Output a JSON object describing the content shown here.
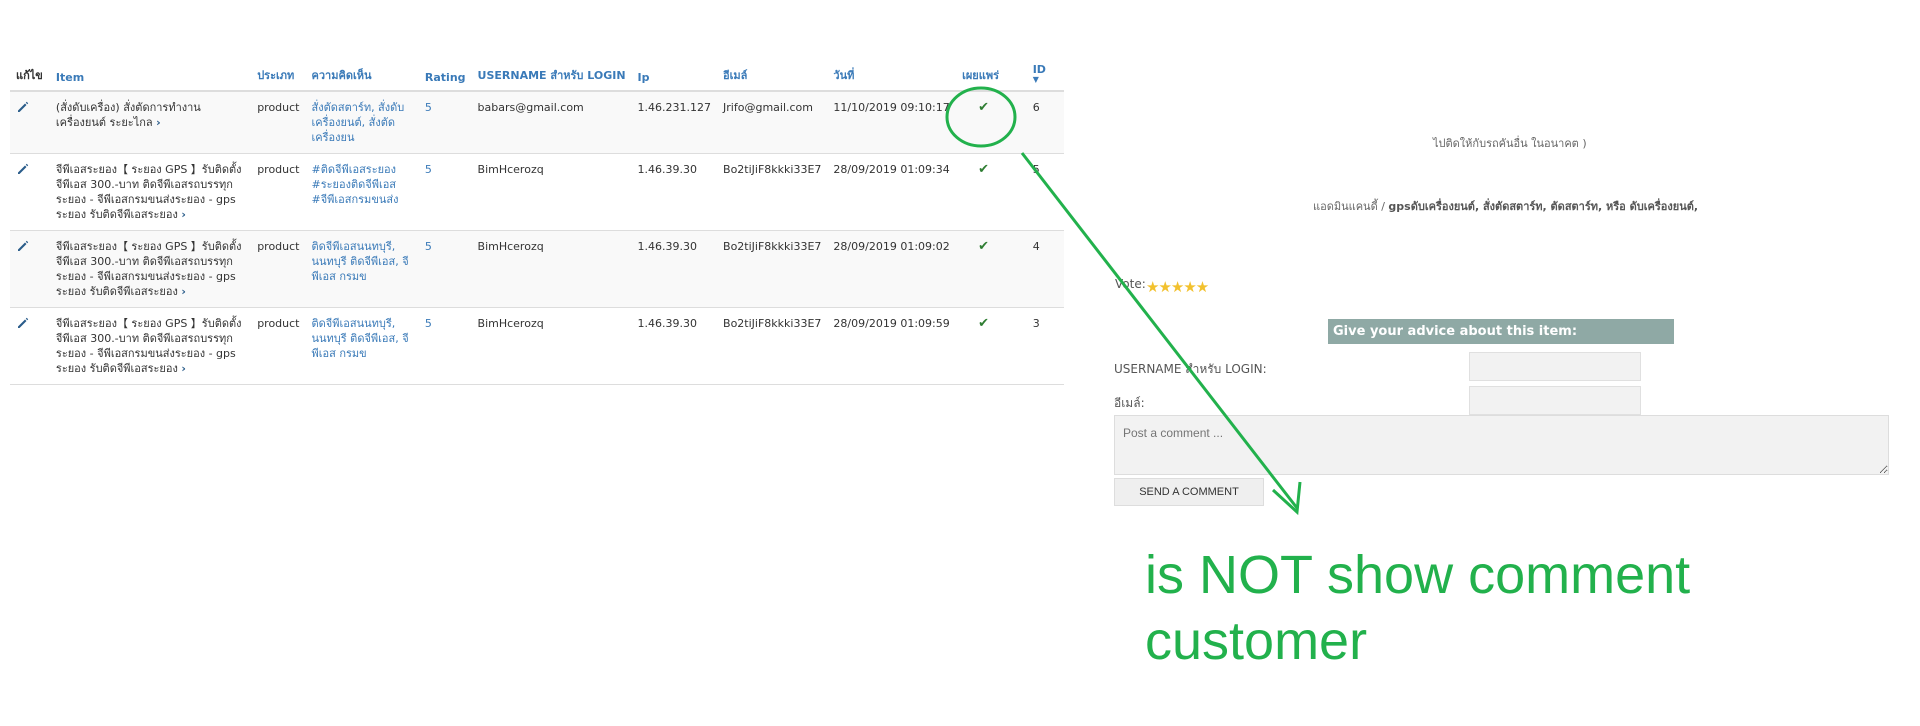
{
  "table": {
    "headers": {
      "edit": "แก้ไข",
      "item": "Item",
      "type": "ประเภท",
      "comment": "ความคิดเห็น",
      "rating": "Rating",
      "username": "USERNAME สำหรับ LOGIN",
      "ip": "Ip",
      "email": "อีเมล์",
      "date": "วันที่",
      "published": "เผยแพร่",
      "id": "ID",
      "id_sort": "▼"
    },
    "rows": [
      {
        "item": "(สั่งดับเครื่อง) สั่งตัดการทำงานเครื่องยนต์ ระยะไกล",
        "type": "product",
        "comment": "สั่งตัดสตาร์ท, สั่งดับ เครื่องยนต์, สั่งตัด เครื่องยน",
        "rating": "5",
        "username": "babars@gmail.com",
        "ip": "1.46.231.127",
        "email": "Jrifo@gmail.com",
        "date": "11/10/2019 09:10:17",
        "id": "6"
      },
      {
        "item": "จีพีเอสระยอง【 ระยอง GPS 】รับติดตั้ง จีพีเอส 300.-บาท ติดจีพีเอสรถบรรทุก ระยอง - จีพีเอสกรมขนส่งระยอง - gps ระยอง รับติดจีพีเอสระยอง",
        "type": "product",
        "comment": "#ติดจีพีเอสระยอง #ระยองติดจีพีเอส #จีพีเอสกรมขนส่ง",
        "rating": "5",
        "username": "BimHcerozq",
        "ip": "1.46.39.30",
        "email": "Bo2tiJiF8kkki33E7",
        "date": "28/09/2019 01:09:34",
        "id": "5"
      },
      {
        "item": "จีพีเอสระยอง【 ระยอง GPS 】รับติดตั้ง จีพีเอส 300.-บาท ติดจีพีเอสรถบรรทุก ระยอง - จีพีเอสกรมขนส่งระยอง - gps ระยอง รับติดจีพีเอสระยอง",
        "type": "product",
        "comment": "ติดจีพีเอสนนทบุรี, นนทบุรี ติดจีพีเอส, จีพีเอส กรมข",
        "rating": "5",
        "username": "BimHcerozq",
        "ip": "1.46.39.30",
        "email": "Bo2tiJiF8kkki33E7",
        "date": "28/09/2019 01:09:02",
        "id": "4"
      },
      {
        "item": "จีพีเอสระยอง【 ระยอง GPS 】รับติดตั้ง จีพีเอส 300.-บาท ติดจีพีเอสรถบรรทุก ระยอง - จีพีเอสกรมขนส่งระยอง - gps ระยอง รับติดจีพีเอสระยอง",
        "type": "product",
        "comment": "ติดจีพีเอสนนทบุรี, นนทบุรี ติดจีพีเอส, จีพีเอส กรมข",
        "rating": "5",
        "username": "BimHcerozq",
        "ip": "1.46.39.30",
        "email": "Bo2tiJiF8kkki33E7",
        "date": "28/09/2019 01:09:59",
        "id": "3"
      }
    ]
  },
  "article": {
    "snippet1": "ไปติดให้กับรถคันอื่น ในอนาคต )",
    "snippet2_prefix": "แอดมินแคนดี้ / ",
    "snippet2_bold": "gpsดับเครื่องยนต์, สั่งตัดสตาร์ท, ตัดสตาร์ท, หรือ ดับเครื่องยนต์,",
    "vote_label": "Vote:",
    "vote_stars": "★★★★★",
    "vote_value": 5,
    "vote_max": 5
  },
  "form": {
    "header": "Give your advice about this item:",
    "username_label": "USERNAME สำหรับ LOGIN:",
    "email_label": "อีเมล์:",
    "comment_placeholder": "Post a comment ...",
    "send_label": "SEND A COMMENT"
  },
  "annotation": {
    "text": "is NOT show comment customer",
    "color": "#22b14c"
  }
}
